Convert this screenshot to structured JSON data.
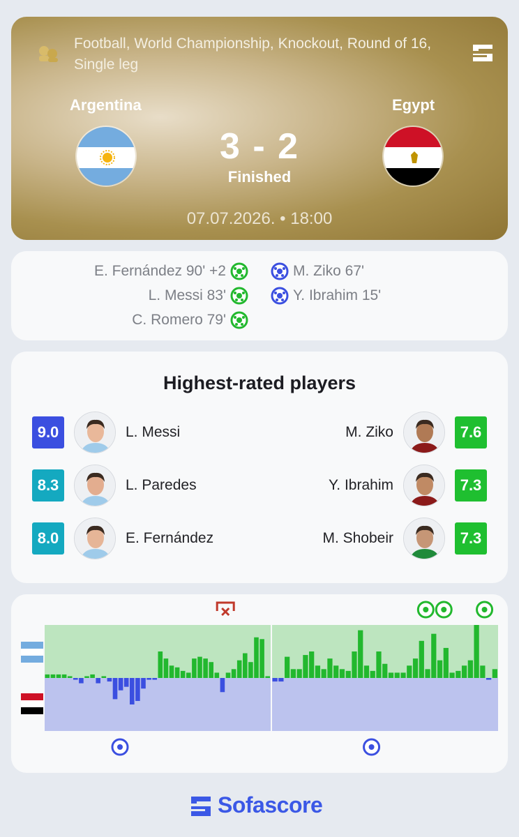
{
  "header": {
    "tournament": "Football, World Championship, Knockout, Round of 16, Single leg",
    "home_team": "Argentina",
    "away_team": "Egypt",
    "score": "3 - 2",
    "status": "Finished",
    "datetime": "07.07.2026. • 18:00"
  },
  "goals": {
    "home": [
      "E. Fernández 90' +2",
      "L. Messi 83'",
      "C. Romero 79'"
    ],
    "away": [
      "M. Ziko 67'",
      "Y. Ibrahim 15'"
    ]
  },
  "rated": {
    "title": "Highest-rated players",
    "home": [
      {
        "name": "L. Messi",
        "rating": "9.0",
        "color": "#3b4fe0"
      },
      {
        "name": "L. Paredes",
        "rating": "8.3",
        "color": "#14a9c0"
      },
      {
        "name": "E. Fernández",
        "rating": "8.0",
        "color": "#14a9c0"
      }
    ],
    "away": [
      {
        "name": "M. Ziko",
        "rating": "7.6",
        "color": "#1fbf30"
      },
      {
        "name": "Y. Ibrahim",
        "rating": "7.3",
        "color": "#1fbf30"
      },
      {
        "name": "M. Shobeir",
        "rating": "7.3",
        "color": "#1fbf30"
      }
    ]
  },
  "momentum": {
    "home_color": "#22b82e",
    "away_color": "#3b4fe0",
    "home_bg": "#bde5bf",
    "away_bg": "#bcc3ee",
    "first_half": [
      2,
      2,
      2,
      2,
      1,
      -1,
      -3,
      1,
      2,
      -3,
      1,
      -2,
      -12,
      -7,
      -5,
      -15,
      -13,
      -6,
      -1,
      -1,
      15,
      11,
      7,
      6,
      4,
      3,
      11,
      12,
      11,
      9,
      3,
      -8,
      3,
      5,
      10,
      14,
      9,
      23,
      22,
      1
    ],
    "second_half": [
      -2,
      -2,
      12,
      5,
      5,
      13,
      15,
      7,
      5,
      11,
      7,
      5,
      4,
      15,
      27,
      7,
      4,
      15,
      8,
      3,
      3,
      3,
      7,
      11,
      21,
      5,
      25,
      10,
      17,
      3,
      4,
      7,
      10,
      30,
      7,
      -1,
      5
    ],
    "home_goal_minutes": [
      79,
      83,
      92
    ],
    "away_goal_minutes": [
      15,
      67
    ],
    "home_missed_penalty_minute": [
      36
    ]
  },
  "brand": "Sofascore"
}
